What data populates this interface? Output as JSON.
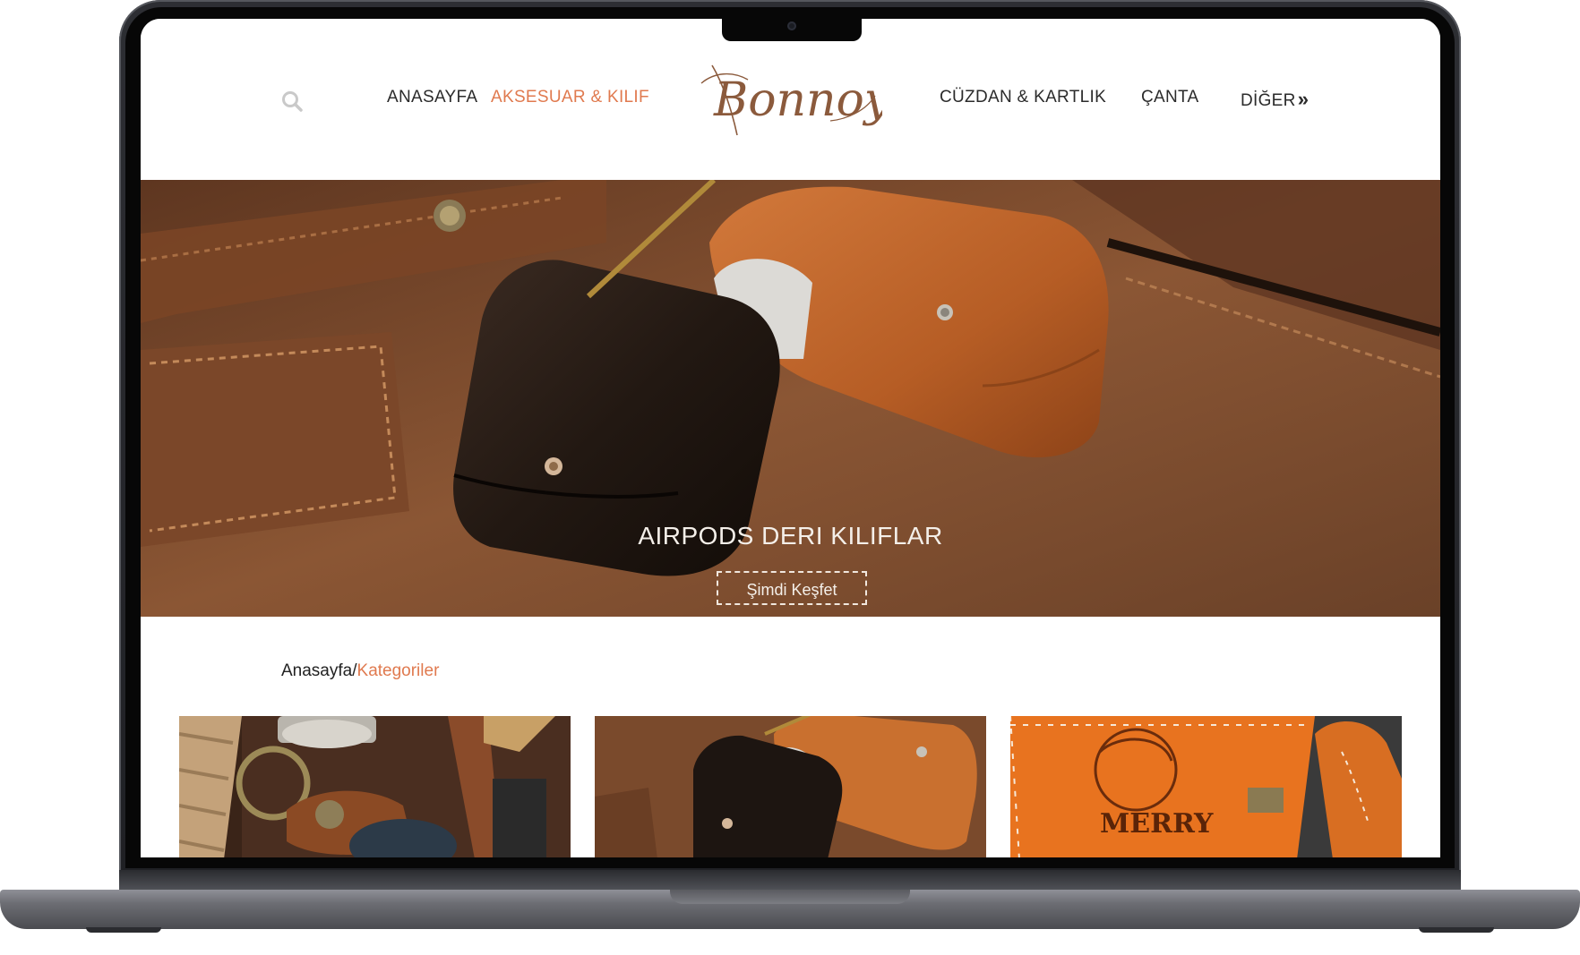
{
  "nav": {
    "home": "ANASAYFA",
    "accessories": "AKSESUAR & KILIF",
    "wallet": "CÜZDAN & KARTLIK",
    "bag": "ÇANTA",
    "more": "DİĞER",
    "more_icon": "chevron-double-right-icon"
  },
  "logo": {
    "text": "Bonnoy"
  },
  "hero": {
    "title": "AIRPODS DERI KILIFLAR",
    "button": "Şimdi Keşfet"
  },
  "breadcrumb": {
    "home": "Anasayfa",
    "separator": "/",
    "current": "Kategoriler"
  },
  "colors": {
    "accent": "#e07a4f",
    "text": "#2b2b2b",
    "leather": "#8a5533"
  }
}
